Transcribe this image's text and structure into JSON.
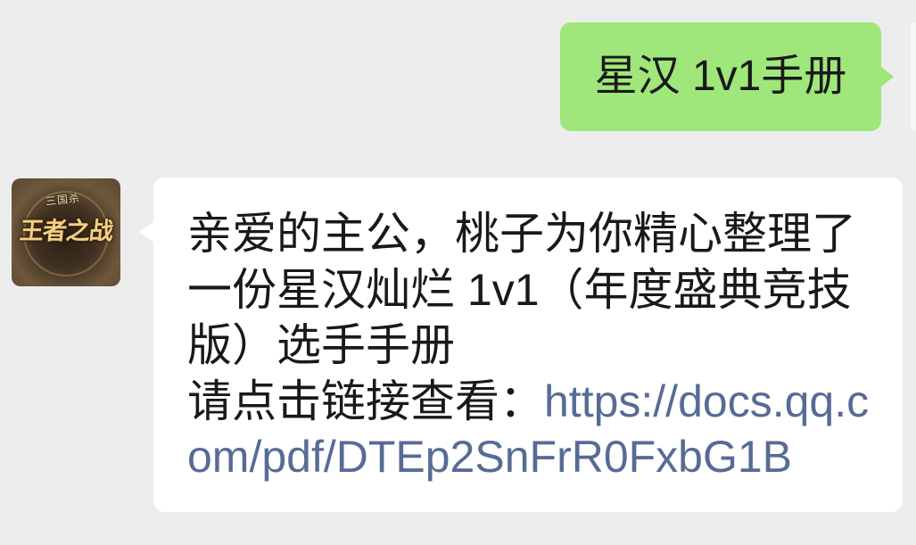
{
  "colors": {
    "background": "#ededed",
    "sent_bubble": "#9fe77a",
    "received_bubble": "#ffffff",
    "text": "#191919",
    "link": "#576b95"
  },
  "sent_message": {
    "text": "星汉 1v1手册"
  },
  "received_message": {
    "sender_avatar": {
      "icon": "game-logo-avatar",
      "logo_small_text": "三国杀",
      "logo_main_text": "王者之战"
    },
    "text": "亲爱的主公，桃子为你精心整理了一份星汉灿烂 1v1（年度盛典竞技版）选手手册",
    "link_prompt": "请点击链接查看：",
    "link_url": "https://docs.qq.com/pdf/DTEp2SnFrR0FxbG1B"
  }
}
